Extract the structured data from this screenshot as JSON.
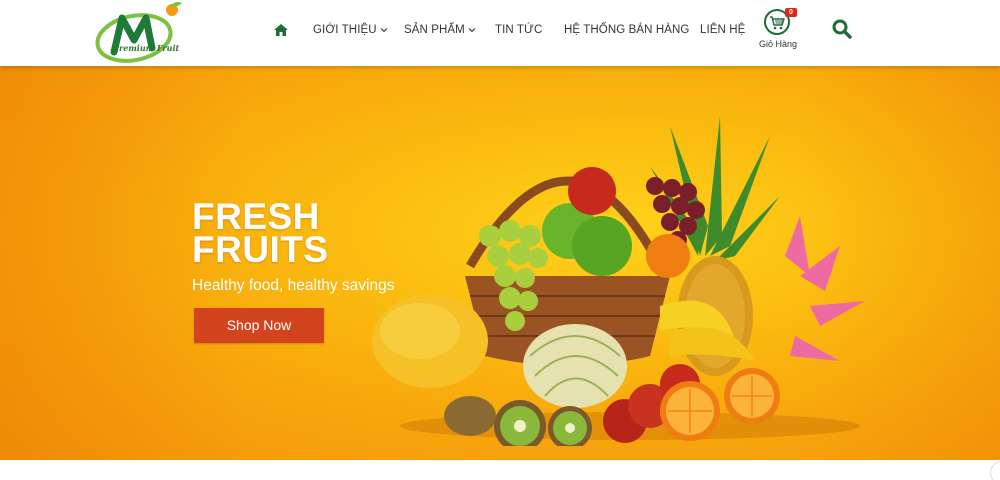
{
  "brand": {
    "logo_letter": "M",
    "logo_tagline": "Premium Fruit",
    "colors": {
      "green": "#1f7a3a",
      "orange": "#f39c12",
      "leaf": "#7cc242"
    }
  },
  "nav": {
    "home_icon": "home-icon",
    "items": [
      {
        "label": "GIỚI THIỆU",
        "has_dropdown": true
      },
      {
        "label": "SẢN PHẨM",
        "has_dropdown": true
      },
      {
        "label": "TIN TỨC",
        "has_dropdown": false
      },
      {
        "label": "HỆ THỐNG BÁN HÀNG",
        "has_dropdown": false
      },
      {
        "label": "LIÊN HỆ",
        "has_dropdown": false
      }
    ]
  },
  "cart": {
    "count": "0",
    "label": "Giỏ Hàng",
    "icon": "cart-icon"
  },
  "search": {
    "icon": "search-icon"
  },
  "hero": {
    "title_line1": "FRESH",
    "title_line2": "FRUITS",
    "subtitle": "Healthy food, healthy savings",
    "button_label": "Shop Now",
    "colors": {
      "background": "#f8a60c",
      "button": "#d3431e"
    }
  }
}
